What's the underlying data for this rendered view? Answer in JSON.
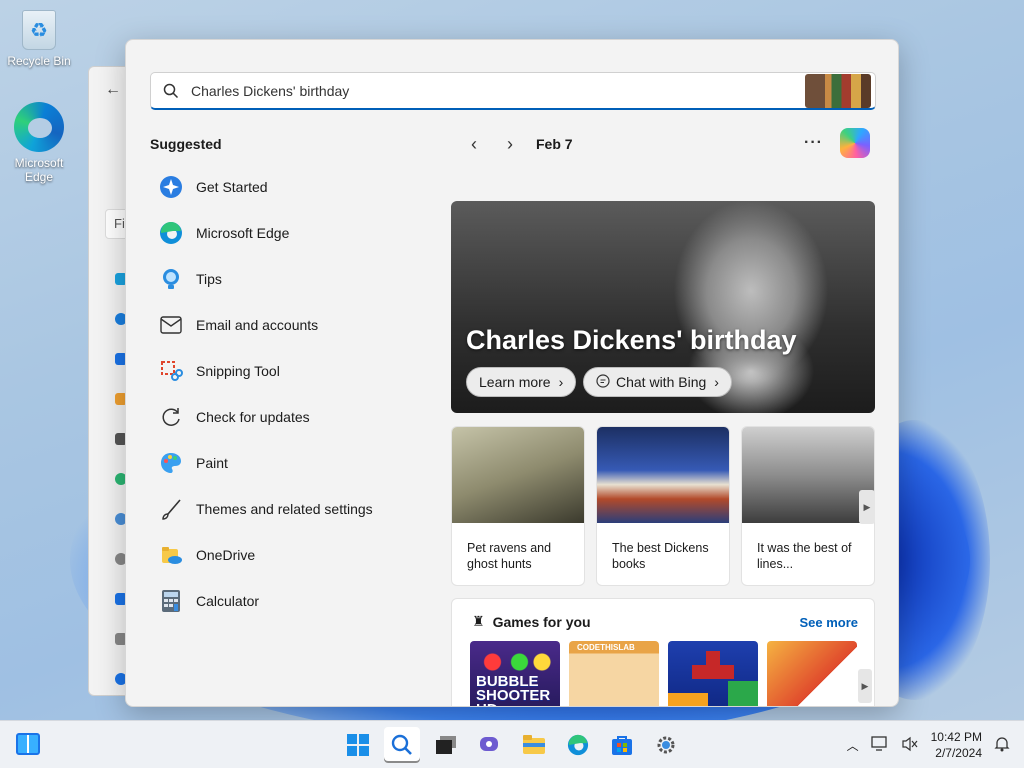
{
  "desktop": {
    "icons": [
      {
        "label": "Recycle Bin"
      },
      {
        "label": "Microsoft Edge"
      }
    ]
  },
  "background_window": {
    "search_stub": "Fi"
  },
  "search": {
    "value": "Charles Dickens' birthday",
    "placeholder": "Charles Dickens' birthday"
  },
  "suggested": {
    "title": "Suggested",
    "items": [
      {
        "label": "Get Started",
        "icon": "get-started-icon"
      },
      {
        "label": "Microsoft Edge",
        "icon": "edge-icon"
      },
      {
        "label": "Tips",
        "icon": "tips-icon"
      },
      {
        "label": "Email and accounts",
        "icon": "mail-icon"
      },
      {
        "label": "Snipping Tool",
        "icon": "snipping-tool-icon"
      },
      {
        "label": "Check for updates",
        "icon": "refresh-icon"
      },
      {
        "label": "Paint",
        "icon": "paint-icon"
      },
      {
        "label": "Themes and related settings",
        "icon": "brush-icon"
      },
      {
        "label": "OneDrive",
        "icon": "onedrive-icon"
      },
      {
        "label": "Calculator",
        "icon": "calculator-icon"
      }
    ]
  },
  "highlights": {
    "date": "Feb 7",
    "more_label": "···",
    "hero": {
      "title": "Charles Dickens' birthday",
      "learn_more": "Learn more",
      "chat": "Chat with Bing"
    },
    "cards": [
      {
        "caption": "Pet ravens and ghost hunts"
      },
      {
        "caption": "The best Dickens books"
      },
      {
        "caption": "It was the best of lines..."
      }
    ],
    "games": {
      "title": "Games for you",
      "see_more": "See more",
      "tiles": [
        {
          "label": "BUBBLE SHOOTER HD"
        },
        {
          "label": "CODETHISLAB"
        },
        {
          "label": ""
        },
        {
          "label": ""
        }
      ]
    }
  },
  "taskbar": {
    "time": "10:42 PM",
    "date": "2/7/2024"
  },
  "colors": {
    "accent": "#005fb8",
    "panel_bg": "#f3f3f3"
  }
}
